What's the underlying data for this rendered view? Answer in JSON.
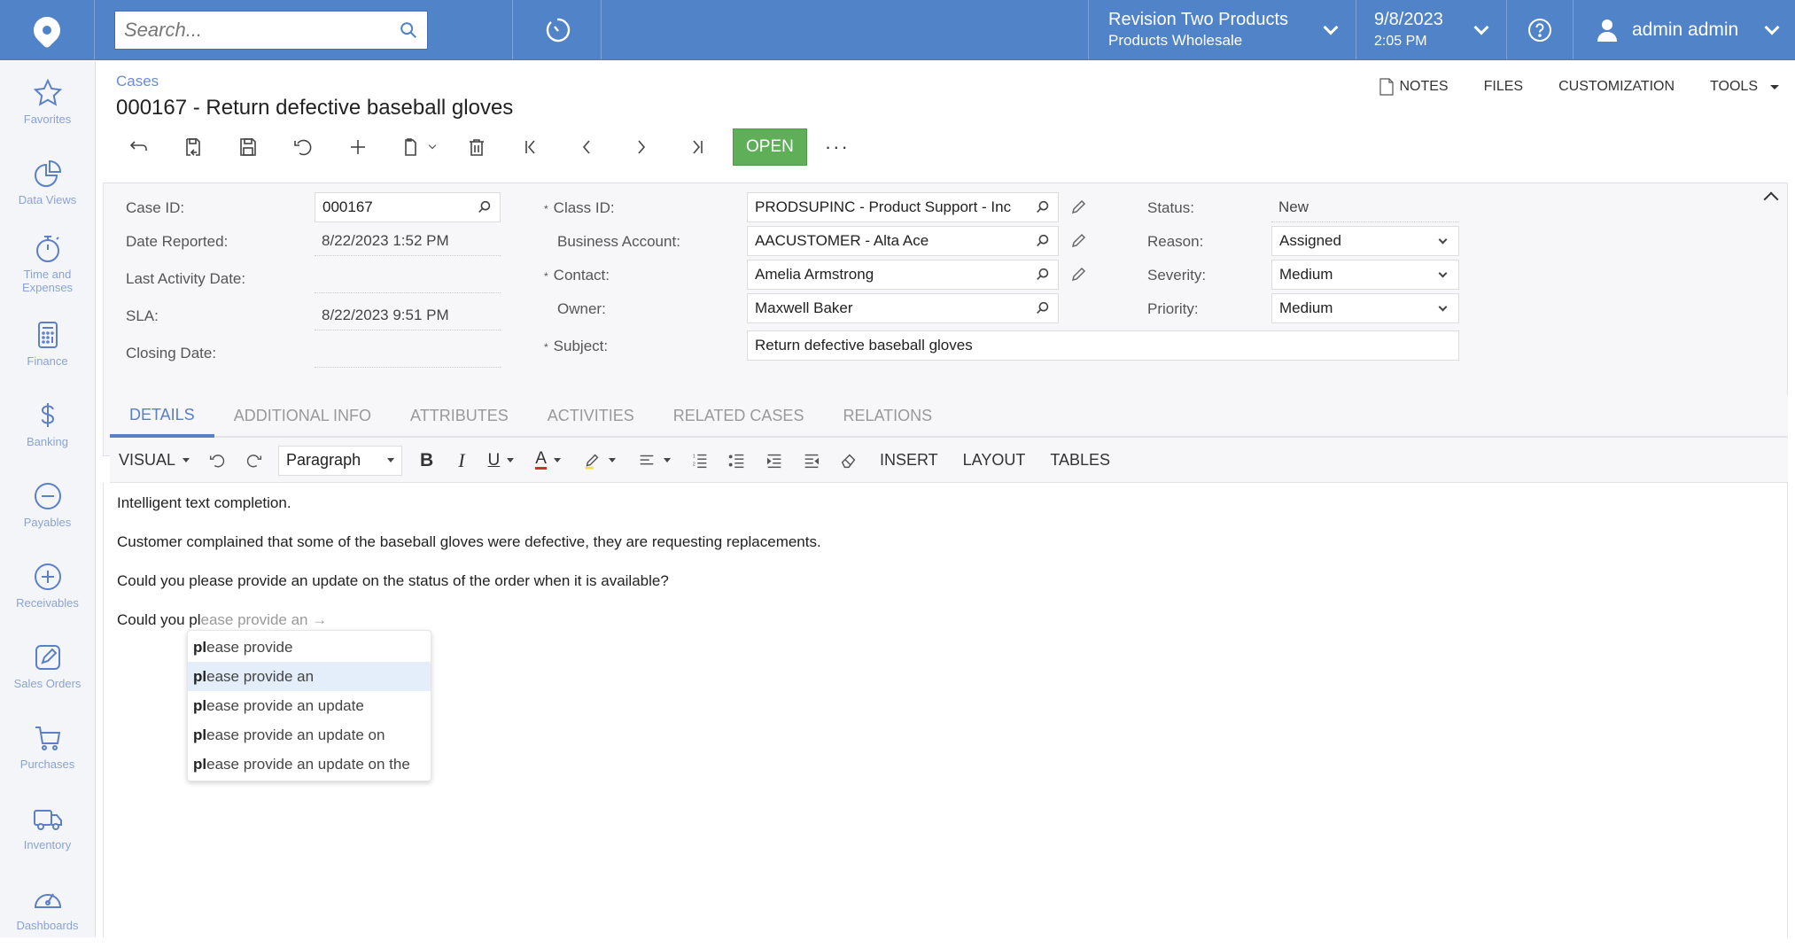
{
  "topbar": {
    "search_placeholder": "Search...",
    "company": "Revision Two Products",
    "branch": "Products Wholesale",
    "date": "9/8/2023",
    "time": "2:05 PM",
    "user": "admin admin"
  },
  "sidebar": {
    "items": [
      {
        "label": "Favorites",
        "icon": "star-icon"
      },
      {
        "label": "Data Views",
        "icon": "pie-chart-icon"
      },
      {
        "label": "Time and Expenses",
        "icon": "stopwatch-icon"
      },
      {
        "label": "Finance",
        "icon": "calculator-icon"
      },
      {
        "label": "Banking",
        "icon": "dollar-icon"
      },
      {
        "label": "Payables",
        "icon": "minus-circle-icon"
      },
      {
        "label": "Receivables",
        "icon": "plus-circle-icon"
      },
      {
        "label": "Sales Orders",
        "icon": "edit-square-icon"
      },
      {
        "label": "Purchases",
        "icon": "cart-icon"
      },
      {
        "label": "Inventory",
        "icon": "truck-icon"
      },
      {
        "label": "Dashboards",
        "icon": "gauge-icon"
      }
    ]
  },
  "header": {
    "breadcrumb": "Cases",
    "title": "000167 - Return defective baseball gloves",
    "links": {
      "notes": "NOTES",
      "files": "FILES",
      "customization": "CUSTOMIZATION",
      "tools": "TOOLS"
    }
  },
  "toolbar": {
    "open_label": "OPEN",
    "more_label": "···"
  },
  "form": {
    "case_id": {
      "label": "Case ID:",
      "value": "000167"
    },
    "date_reported": {
      "label": "Date Reported:",
      "value": "8/22/2023 1:52 PM"
    },
    "last_activity": {
      "label": "Last Activity Date:",
      "value": ""
    },
    "sla": {
      "label": "SLA:",
      "value": "8/22/2023 9:51 PM"
    },
    "closing_date": {
      "label": "Closing Date:",
      "value": ""
    },
    "class_id": {
      "label": "Class ID:",
      "value": "PRODSUPINC - Product Support - Inc"
    },
    "business_account": {
      "label": "Business Account:",
      "value": "AACUSTOMER - Alta Ace"
    },
    "contact": {
      "label": "Contact:",
      "value": "Amelia Armstrong"
    },
    "owner": {
      "label": "Owner:",
      "value": "Maxwell Baker"
    },
    "subject": {
      "label": "Subject:",
      "value": "Return defective baseball gloves"
    },
    "status": {
      "label": "Status:",
      "value": "New"
    },
    "reason": {
      "label": "Reason:",
      "value": "Assigned"
    },
    "severity": {
      "label": "Severity:",
      "value": "Medium"
    },
    "priority": {
      "label": "Priority:",
      "value": "Medium"
    },
    "required_mark": "*"
  },
  "tabs": [
    {
      "label": "DETAILS",
      "active": true
    },
    {
      "label": "ADDITIONAL INFO"
    },
    {
      "label": "ATTRIBUTES"
    },
    {
      "label": "ACTIVITIES"
    },
    {
      "label": "RELATED CASES"
    },
    {
      "label": "RELATIONS"
    }
  ],
  "editor_toolbar": {
    "mode": "VISUAL",
    "paragraph": "Paragraph",
    "insert": "INSERT",
    "layout": "LAYOUT",
    "tables": "TABLES",
    "highlight_color": "#f0e040",
    "font_color": "#d03030"
  },
  "editor": {
    "paragraphs": [
      "Intelligent text completion.",
      "Customer complained that some of the baseball gloves were defective, they are requesting replacements.",
      "Could you please provide an update on the status of the order when it is available?"
    ],
    "typed": "Could you pl",
    "ghost": "ease provide an →"
  },
  "suggestions": {
    "prefix": "pl",
    "items": [
      {
        "rest": "ease provide"
      },
      {
        "rest": "ease provide an",
        "active": true
      },
      {
        "rest": "ease provide an update"
      },
      {
        "rest": "ease provide an update on"
      },
      {
        "rest": "ease provide an update on the"
      }
    ]
  }
}
